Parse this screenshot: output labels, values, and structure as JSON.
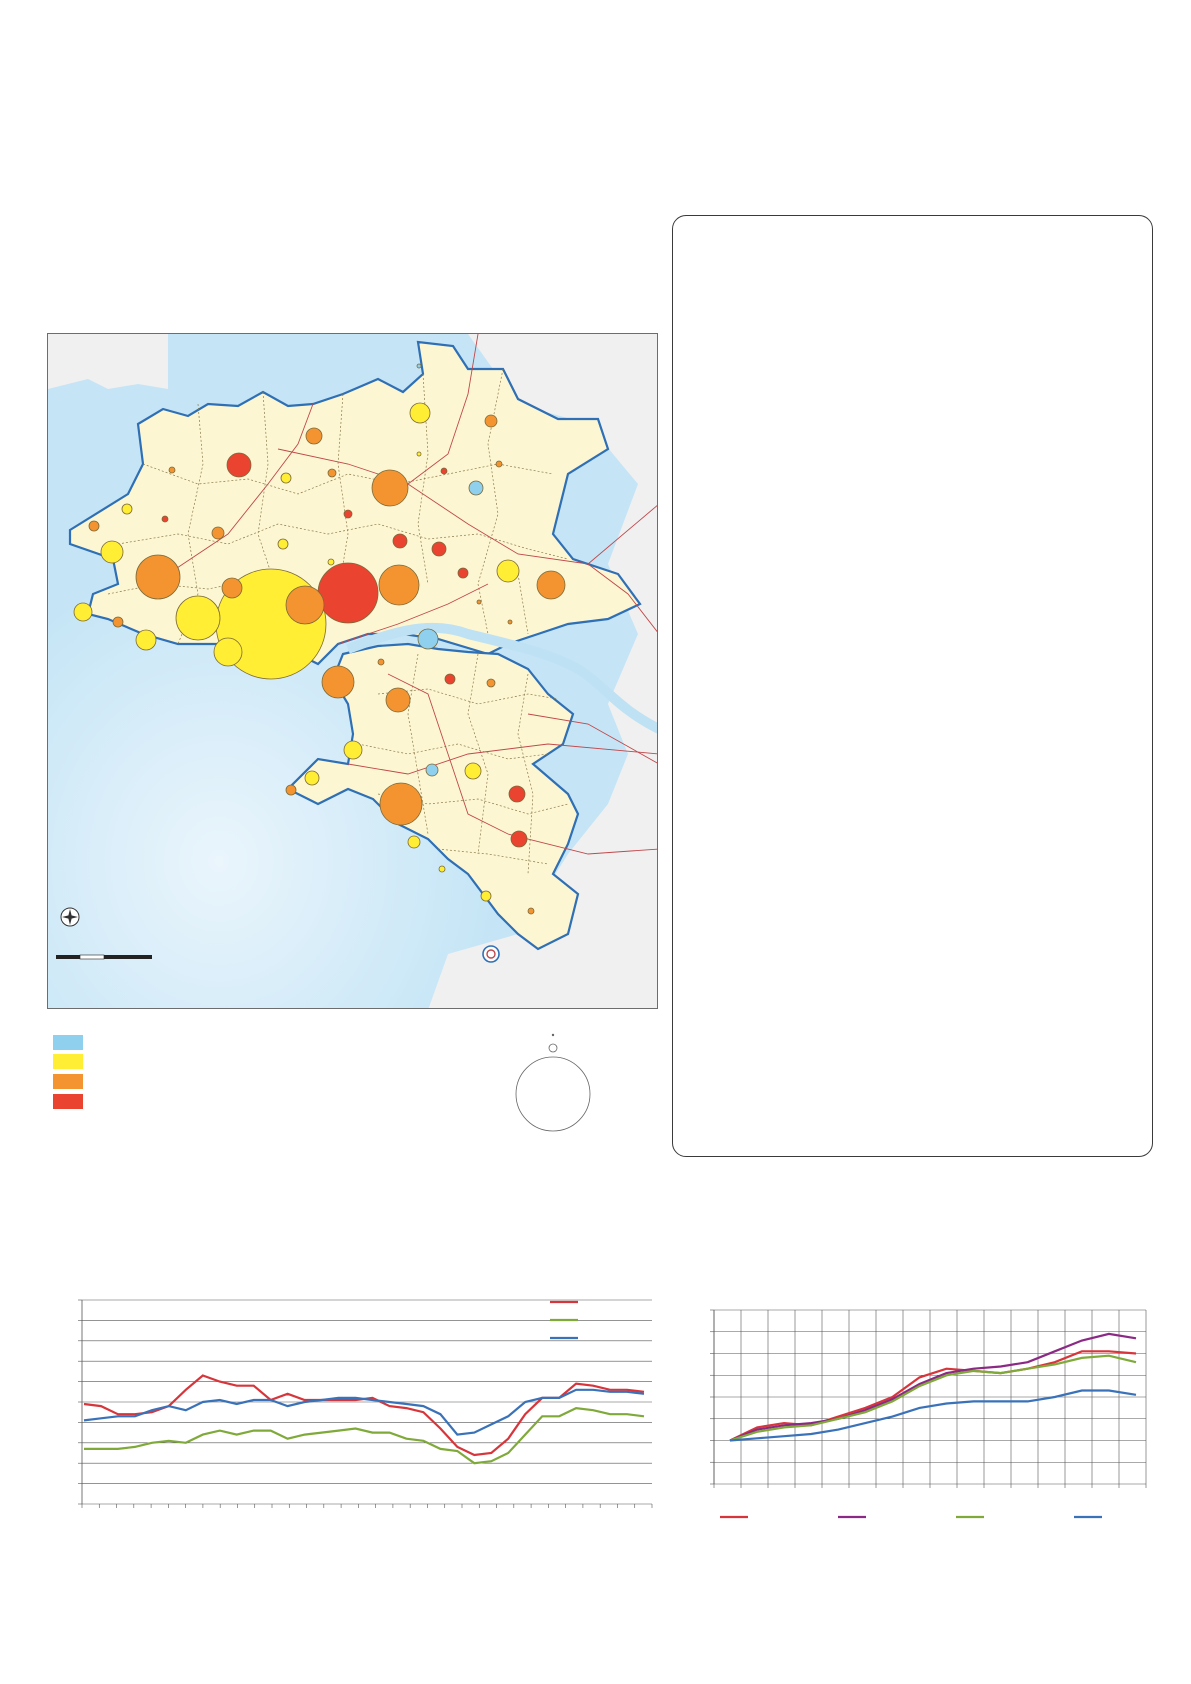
{
  "colors": {
    "sea": "#c5e5f6",
    "land": "#fdf6d2",
    "boundary": "#2e6fb5",
    "outside": "#f0f0f0",
    "road": "#c0484b",
    "commune_line": "#8a7a4a",
    "river": "#bfe1f4"
  },
  "legend": {
    "swatches": [
      {
        "color": "#8fd0ee",
        "icon": "blue-class-swatch"
      },
      {
        "color": "#ffee33",
        "icon": "yellow-class-swatch"
      },
      {
        "color": "#f39430",
        "icon": "orange-class-swatch"
      },
      {
        "color": "#ea4330",
        "icon": "red-class-swatch"
      }
    ]
  },
  "map_icons": [
    "compass-rose-icon",
    "scale-bar",
    "spiral-logo-icon"
  ],
  "chart_data": [
    {
      "type": "line",
      "id": "left-line-chart",
      "title": "",
      "xlabel": "",
      "ylabel": "",
      "grid": "horizontal",
      "legend": "top-right",
      "ylim": [
        0,
        10
      ],
      "x_count": 34,
      "series": [
        {
          "color": "#d6363b",
          "values": [
            4.9,
            4.8,
            4.4,
            4.4,
            4.5,
            4.8,
            5.6,
            6.3,
            6.0,
            5.8,
            5.8,
            5.1,
            5.4,
            5.1,
            5.1,
            5.1,
            5.1,
            5.2,
            4.8,
            4.7,
            4.5,
            3.7,
            2.8,
            2.4,
            2.5,
            3.2,
            4.4,
            5.2,
            5.2,
            5.9,
            5.8,
            5.6,
            5.6,
            5.5
          ]
        },
        {
          "color": "#7faa3a",
          "values": [
            2.7,
            2.7,
            2.7,
            2.8,
            3.0,
            3.1,
            3.0,
            3.4,
            3.6,
            3.4,
            3.6,
            3.6,
            3.2,
            3.4,
            3.5,
            3.6,
            3.7,
            3.5,
            3.5,
            3.2,
            3.1,
            2.7,
            2.6,
            2.0,
            2.1,
            2.5,
            3.4,
            4.3,
            4.3,
            4.7,
            4.6,
            4.4,
            4.4,
            4.3
          ]
        },
        {
          "color": "#3a72b9",
          "values": [
            4.1,
            4.2,
            4.3,
            4.3,
            4.6,
            4.8,
            4.6,
            5.0,
            5.1,
            4.9,
            5.1,
            5.1,
            4.8,
            5.0,
            5.1,
            5.2,
            5.2,
            5.1,
            5.0,
            4.9,
            4.8,
            4.4,
            3.4,
            3.5,
            3.9,
            4.3,
            5.0,
            5.2,
            5.2,
            5.6,
            5.6,
            5.5,
            5.5,
            5.4
          ]
        }
      ]
    },
    {
      "type": "line",
      "id": "right-line-chart",
      "title": "",
      "xlabel": "",
      "ylabel": "",
      "grid": "both",
      "legend": "bottom",
      "ylim": [
        0,
        8
      ],
      "x_count": 17,
      "series": [
        {
          "color": "#d6363b",
          "values": [
            2.0,
            2.6,
            2.8,
            2.7,
            3.1,
            3.5,
            4.0,
            4.9,
            5.3,
            5.2,
            5.1,
            5.3,
            5.6,
            6.1,
            6.1,
            6.0
          ]
        },
        {
          "color": "#8b2a85",
          "values": [
            2.0,
            2.5,
            2.7,
            2.8,
            3.0,
            3.4,
            3.9,
            4.6,
            5.1,
            5.3,
            5.4,
            5.6,
            6.1,
            6.6,
            6.9,
            6.7
          ]
        },
        {
          "color": "#7faa3a",
          "values": [
            2.0,
            2.4,
            2.6,
            2.7,
            3.0,
            3.3,
            3.8,
            4.5,
            5.0,
            5.2,
            5.1,
            5.3,
            5.5,
            5.8,
            5.9,
            5.6
          ]
        },
        {
          "color": "#3a72b9",
          "values": [
            2.0,
            2.1,
            2.2,
            2.3,
            2.5,
            2.8,
            3.1,
            3.5,
            3.7,
            3.8,
            3.8,
            3.8,
            4.0,
            4.3,
            4.3,
            4.1
          ]
        }
      ]
    }
  ]
}
